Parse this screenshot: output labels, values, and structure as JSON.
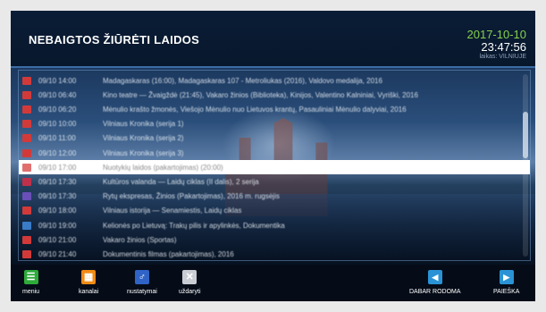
{
  "header": {
    "title": "NEBAIGTOS ŽIŪRĖTI LAIDOS",
    "date": "2017-10-10",
    "time": "23:47:56",
    "timezone_label": "laikas: VILNIUJE"
  },
  "recordings": [
    {
      "icon_color": "#d23a3a",
      "time": "09/10 14:00",
      "title": "Madagaskaras (16:00), Madagaskaras 107 - Metroliukas (2016), Valdovo medalija, 2016",
      "selected": false
    },
    {
      "icon_color": "#d23a3a",
      "time": "09/10 06:40",
      "title": "Kino teatre — Žvaigždė (21:45), Vakaro žinios (Biblioteka), Kinijos, Valentino Kalniniai, Vyriški, 2016",
      "selected": false
    },
    {
      "icon_color": "#d23a3a",
      "time": "09/10 06:20",
      "title": "Mėnulio krašto žmonės, Viešojo Mėnulio nuo Lietuvos krantų, Pasauliniai Mėnulio dalyviai, 2016",
      "selected": false
    },
    {
      "icon_color": "#d23a3a",
      "time": "09/10 10:00",
      "title": "Vilniaus Kronika (serija 1)",
      "selected": false
    },
    {
      "icon_color": "#d23a3a",
      "time": "09/10 11:00",
      "title": "Vilniaus Kronika (serija 2)",
      "selected": false
    },
    {
      "icon_color": "#d23a3a",
      "time": "09/10 12:00",
      "title": "Vilniaus Kronika (serija 3)",
      "selected": false
    },
    {
      "icon_color": "#e07070",
      "time": "09/10 17:00",
      "title": "Nuotykių laidos (pakartojimas) (20:00)",
      "selected": true
    },
    {
      "icon_color": "#c0304a",
      "time": "09/10 17:30",
      "title": "Kultūros valanda — Laidų ciklas (II dalis), 2 serija",
      "selected": false
    },
    {
      "icon_color": "#6a4fb8",
      "time": "09/10 17:30",
      "title": "Rytų ekspresas, Žinios (Pakartojimas), 2016 m. rugsėjis",
      "selected": false
    },
    {
      "icon_color": "#d23a3a",
      "time": "09/10 18:00",
      "title": "Vilniaus istorija — Senamiestis, Laidų ciklas",
      "selected": false
    },
    {
      "icon_color": "#3a7cc8",
      "time": "09/10 19:00",
      "title": "Kelionės po Lietuvą: Trakų pilis ir apylinkės, Dokumentika",
      "selected": false
    },
    {
      "icon_color": "#d23a3a",
      "time": "09/10 21:00",
      "title": "Vakaro žinios (Sportas)",
      "selected": false
    },
    {
      "icon_color": "#d23a3a",
      "time": "09/10 21:40",
      "title": "Dokumentinis filmas (pakartojimas), 2016",
      "selected": false
    }
  ],
  "footer": {
    "buttons": [
      {
        "label": "meniu",
        "icon": "menu-icon",
        "color": "#2eaa3a",
        "glyph": "☰"
      },
      {
        "label": "kanalai",
        "icon": "channels-grid-icon",
        "color": "#f08a14",
        "glyph": "▦"
      },
      {
        "label": "nustatymai",
        "icon": "settings-icon",
        "color": "#2f63c6",
        "glyph": "♂"
      },
      {
        "label": "uždaryti",
        "icon": "close-icon",
        "color": "#c9cdd3",
        "glyph": "✕"
      }
    ],
    "right_buttons": [
      {
        "label": "DABAR RODOMA",
        "icon": "arrow-left-icon",
        "color": "#2a93d5",
        "glyph": "◀"
      },
      {
        "label": "PAIEŠKA",
        "icon": "arrow-right-icon",
        "color": "#2a93d5",
        "glyph": "▶"
      }
    ]
  }
}
